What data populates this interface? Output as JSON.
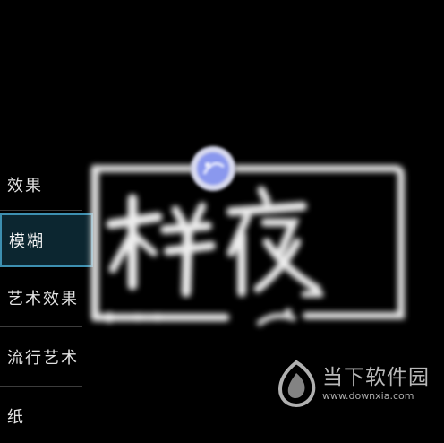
{
  "effects_menu": {
    "items": [
      {
        "label": "效果",
        "selected": false
      },
      {
        "label": "模糊",
        "selected": true
      },
      {
        "label": "艺术效果",
        "selected": false
      },
      {
        "label": "流行艺术",
        "selected": false
      },
      {
        "label": "纸",
        "selected": false
      }
    ]
  },
  "preview": {
    "text_line1": "梓夜",
    "accent_color": "#7f8ff0",
    "stroke_color": "#e8e8e8"
  },
  "watermark": {
    "name": "当下软件园",
    "url": "www.downxia.com"
  }
}
